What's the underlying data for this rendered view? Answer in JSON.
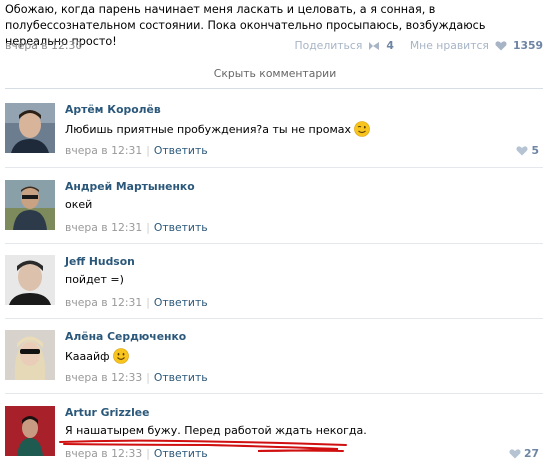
{
  "post": {
    "text": "Обожаю, когда парень начинает меня ласкать и целовать, а я сонная, в полубессознательном состоянии. Пока окончательно просыпаюсь, возбуждаюсь нереально просто!",
    "time": "вчера в 12:30",
    "share_label": "Поделиться",
    "share_count": "4",
    "like_label": "Мне нравится",
    "like_count": "1359"
  },
  "hide_comments_label": "Скрыть комментарии",
  "comments": [
    {
      "author": "Артём Королёв",
      "text": "Любишь приятные пробуждения?а ты не промах",
      "emoji": "wink-emoji",
      "time": "вчера в 12:31",
      "reply_label": "Ответить",
      "likes": "5"
    },
    {
      "author": "Андрей Мартыненко",
      "text": "окей",
      "time": "вчера в 12:31",
      "reply_label": "Ответить"
    },
    {
      "author": "Jeff Hudson",
      "text": "пойдет =)",
      "time": "вчера в 12:31",
      "reply_label": "Ответить"
    },
    {
      "author": "Алёна Сердюченко",
      "text": "Кааайф",
      "emoji": "smile-emoji",
      "time": "вчера в 12:33",
      "reply_label": "Ответить"
    },
    {
      "author": "Artur Grizzlee",
      "text": "Я нашатырем бужу. Перед работой ждать некогда.",
      "time": "вчера в 12:33",
      "reply_label": "Ответить",
      "likes": "27"
    }
  ],
  "colors": {
    "link": "#2b587a",
    "meta": "#999999",
    "like_count": "#6e85a3",
    "underline": "#d01010"
  }
}
